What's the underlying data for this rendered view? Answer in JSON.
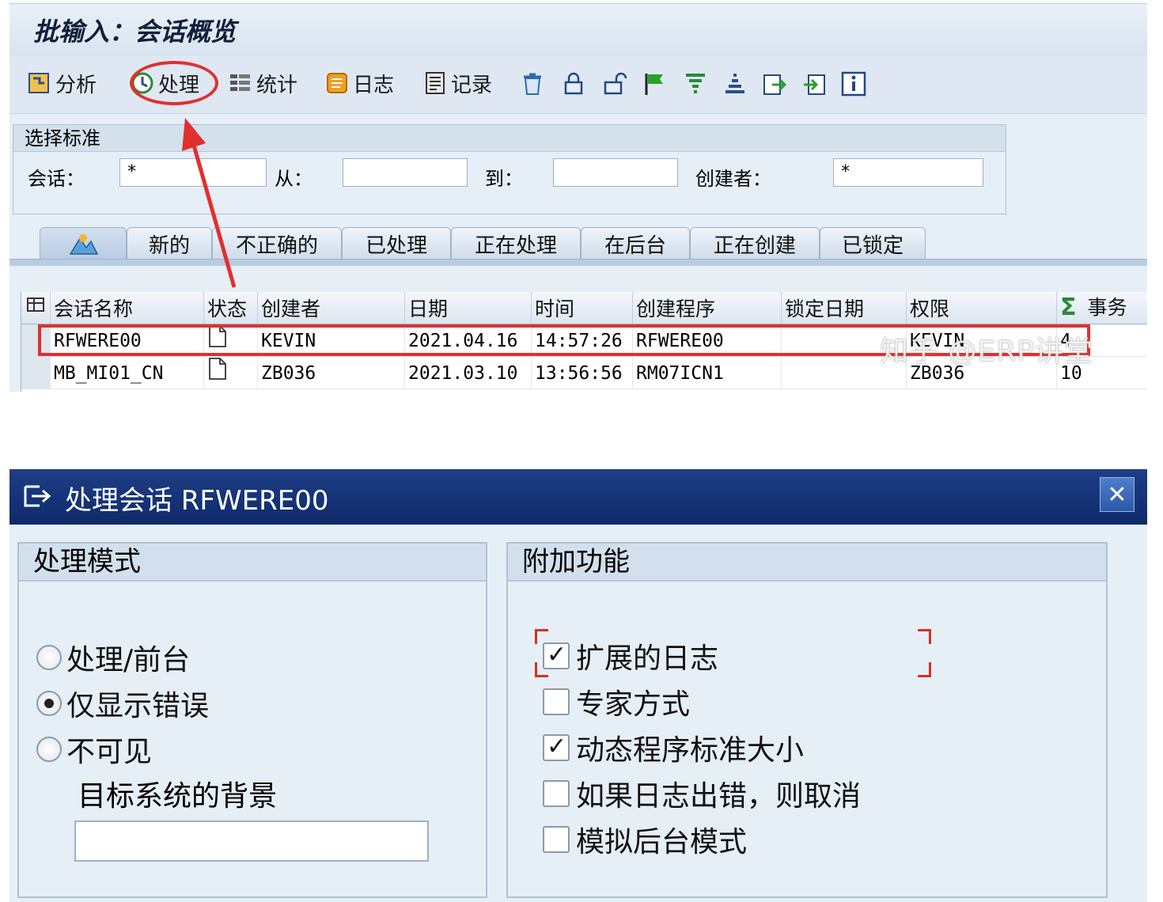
{
  "top": {
    "title": "批输入：会话概览",
    "toolbar": {
      "analyze": "分析",
      "process": "处理",
      "statistics": "统计",
      "log": "日志",
      "record": "记录"
    },
    "selection": {
      "title": "选择标准",
      "session_label": "会话：",
      "session_value": "*",
      "from_label": "从：",
      "from_value": "",
      "to_label": "到：",
      "to_value": "",
      "creator_label": "创建者：",
      "creator_value": "*"
    },
    "tabs": [
      "新的",
      "不正确的",
      "已处理",
      "正在处理",
      "在后台",
      "正在创建",
      "已锁定"
    ],
    "table": {
      "headers": [
        "会话名称",
        "状态",
        "创建者",
        "日期",
        "时间",
        "创建程序",
        "锁定日期",
        "权限",
        "事务"
      ],
      "rows": [
        [
          "RFWERE00",
          "",
          "KEVIN",
          "2021.04.16",
          "14:57:26",
          "RFWERE00",
          "",
          "KEVIN",
          "4"
        ],
        [
          "MB_MI01_CN",
          "",
          "ZB036",
          "2021.03.10",
          "13:56:56",
          "RM07ICN1",
          "",
          "ZB036",
          "10"
        ]
      ]
    },
    "watermark": "知乎 @ERP讲堂"
  },
  "dialog": {
    "title": "处理会话 RFWERE00",
    "mode_group": {
      "title": "处理模式",
      "options": [
        "处理/前台",
        "仅显示错误",
        "不可见"
      ],
      "selected": "仅显示错误",
      "background_label": "目标系统的背景",
      "background_value": ""
    },
    "extra_group": {
      "title": "附加功能",
      "options": [
        {
          "label": "扩展的日志",
          "checked": true
        },
        {
          "label": "专家方式",
          "checked": false
        },
        {
          "label": "动态程序标准大小",
          "checked": true
        },
        {
          "label": "如果日志出错，则取消",
          "checked": false
        },
        {
          "label": "模拟后台模式",
          "checked": false
        }
      ]
    }
  },
  "colors": {
    "highlight": "#e0302e",
    "dialog_title_bg": "#1e3e86",
    "panel_bg": "#e6eef6"
  },
  "icons": [
    "analyze-icon",
    "process-icon",
    "statistics-icon",
    "log-icon",
    "record-icon",
    "delete-icon",
    "lock-icon",
    "unlock-icon",
    "flag-icon",
    "filter-icon",
    "sort-icon",
    "export-icon",
    "import-icon",
    "info-icon",
    "close-icon",
    "sum-icon"
  ]
}
